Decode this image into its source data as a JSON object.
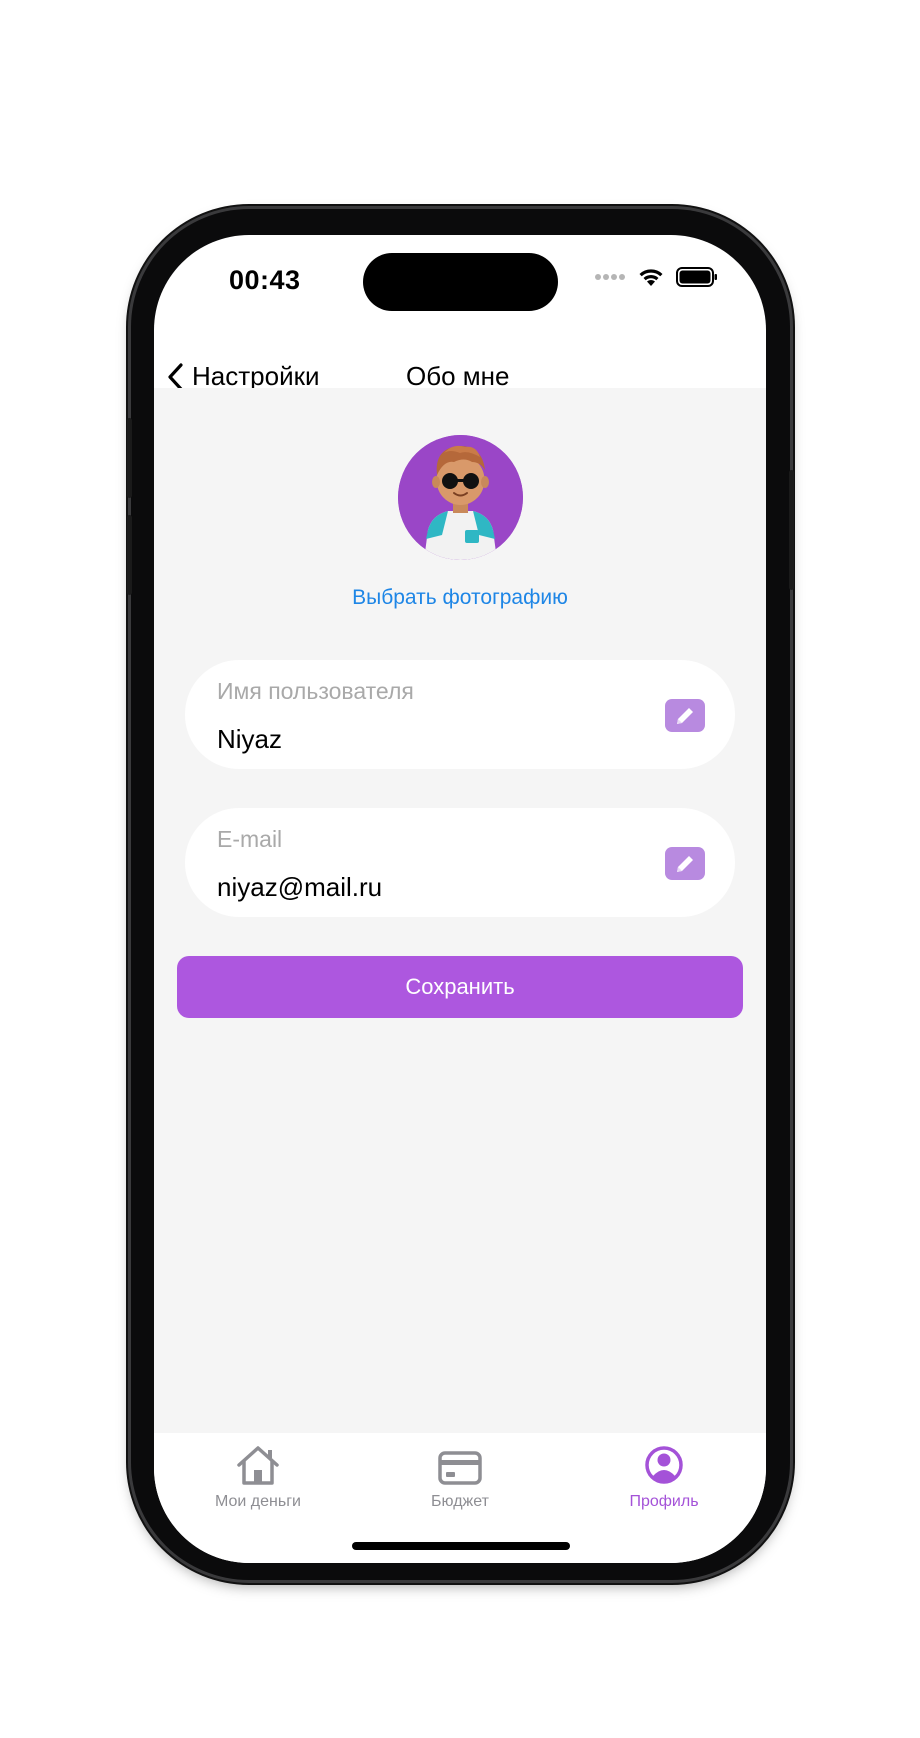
{
  "status_bar": {
    "time": "00:43"
  },
  "nav": {
    "back_label": "Настройки",
    "title": "Обо мне"
  },
  "profile": {
    "choose_photo": "Выбрать фотографию"
  },
  "fields": [
    {
      "label": "Имя пользователя",
      "value": "Niyaz"
    },
    {
      "label": "E-mail",
      "value": "niyaz@mail.ru"
    }
  ],
  "save_label": "Сохранить",
  "tabs": [
    {
      "label": "Мои деньги",
      "icon": "house-icon",
      "active": false
    },
    {
      "label": "Бюджет",
      "icon": "card-icon",
      "active": false
    },
    {
      "label": "Профиль",
      "icon": "person-circle-icon",
      "active": true
    }
  ],
  "colors": {
    "accent": "#ad57df",
    "link": "#1e86e6",
    "background": "#f5f5f5"
  }
}
